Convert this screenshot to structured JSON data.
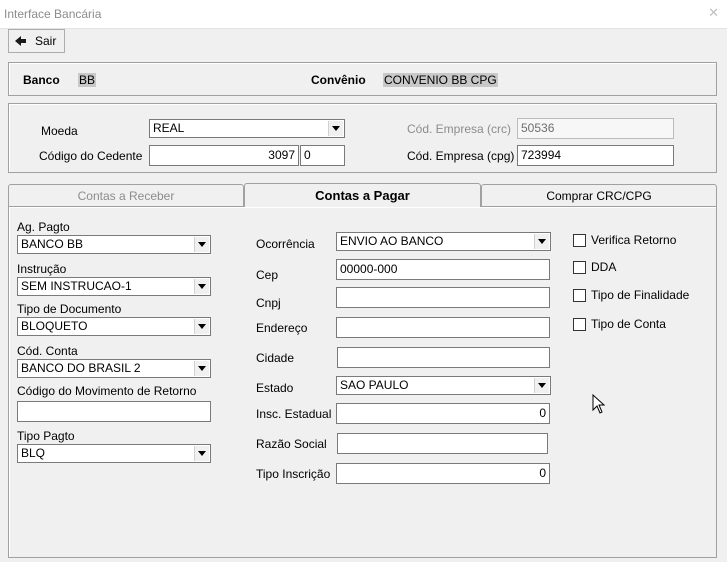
{
  "window": {
    "title": "Interface Bancária"
  },
  "toolbar": {
    "exit_label": "Sair"
  },
  "header": {
    "banco_label": "Banco",
    "banco_value": "BB",
    "convenio_label": "Convênio",
    "convenio_value": "CONVENIO BB CPG"
  },
  "top_form": {
    "moeda_label": "Moeda",
    "moeda_value": "REAL",
    "cedente_label": "Código do Cedente",
    "cedente_value": "3097",
    "cedente_digit": "0",
    "empresa_crc_label": "Cód. Empresa (crc)",
    "empresa_crc_value": "50536",
    "empresa_cpg_label": "Cód. Empresa (cpg)",
    "empresa_cpg_value": "723994"
  },
  "tabs": [
    {
      "label": "Contas a Receber",
      "active": false
    },
    {
      "label": "Contas a Pagar",
      "active": true
    },
    {
      "label": "Comprar CRC/CPG",
      "active": false
    }
  ],
  "left_col": {
    "ag_pagto_label": "Ag. Pagto",
    "ag_pagto_value": "BANCO BB",
    "instrucao_label": "Instrução",
    "instrucao_value": "SEM INSTRUCAO-1",
    "tipo_doc_label": "Tipo de Documento",
    "tipo_doc_value": "BLOQUETO",
    "cod_conta_label": "Cód. Conta",
    "cod_conta_value": "BANCO DO BRASIL 2",
    "cod_mov_label": "Código do Movimento de Retorno",
    "cod_mov_value": "",
    "tipo_pagto_label": "Tipo Pagto",
    "tipo_pagto_value": "BLQ"
  },
  "mid_col": {
    "ocorrencia_label": "Ocorrência",
    "ocorrencia_value": "ENVIO AO BANCO",
    "cep_label": "Cep",
    "cep_value": "00000-000",
    "cnpj_label": "Cnpj",
    "cnpj_value": "",
    "endereco_label": "Endereço",
    "endereco_value": "",
    "cidade_label": "Cidade",
    "cidade_value": "",
    "estado_label": "Estado",
    "estado_value": "SAO PAULO",
    "insc_label": "Insc. Estadual",
    "insc_value": "0",
    "razao_label": "Razão Social",
    "razao_value": "",
    "tipo_insc_label": "Tipo Inscrição",
    "tipo_insc_value": "0"
  },
  "right_col": {
    "verifica_label": "Verifica Retorno",
    "dda_label": "DDA",
    "finalidade_label": "Tipo de Finalidade",
    "conta_label": "Tipo de Conta"
  }
}
